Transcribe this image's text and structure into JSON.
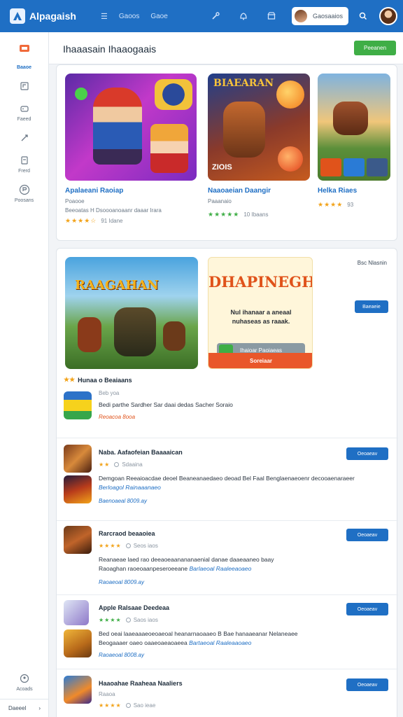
{
  "header": {
    "brand": "Alpagaish",
    "nav": [
      "Gaoos",
      "Gaoe"
    ],
    "user_name": "Gaosaaios"
  },
  "sidebar": {
    "items": [
      {
        "label": "Baaoe",
        "icon": "home-icon"
      },
      {
        "label": "",
        "icon": "store-icon"
      },
      {
        "label": "Faeed",
        "icon": "gamepad-icon"
      },
      {
        "label": "",
        "icon": "rocket-icon"
      },
      {
        "label": "Frerd",
        "icon": "library-icon"
      },
      {
        "label": "Poosans",
        "icon": "profile-icon"
      }
    ],
    "bottom_item": "Acoads",
    "footer": "Daeeel"
  },
  "page": {
    "title": "Ihaaasain Ihaaogaais",
    "action_button": "Peeanen"
  },
  "featured": [
    {
      "title": "Apalaeani Raoiap",
      "line1": "Poaooe",
      "line2": "Beeoatas H Dsoooanoaanr daaar Irara",
      "stars": "★★★★☆",
      "count": "91 Idane",
      "star_color": "orange"
    },
    {
      "title": "Naaoaeian Daangir",
      "line1": "Paaanaio",
      "line2": "",
      "stars": "★★★★★",
      "count": "10 Ibaans",
      "star_color": "green"
    },
    {
      "title": "Helka Riaes",
      "line1": "",
      "line2": "",
      "stars": "★★★★",
      "count": "93",
      "star_color": "orange"
    }
  ],
  "featured_art_text": [
    "BIAEARAN",
    "ZIOIS"
  ],
  "promo": {
    "art_text": "RAAGAHAN",
    "title": "DHAPINEGH",
    "text": "Nul ihanaar a aneaal nuhaseas as raaak.",
    "install_label": "Ihaioar Paoiaeas",
    "cta": "Soreiaar",
    "see_all": "Bsc Nlasnin",
    "side_button": "Baeaeie"
  },
  "section_heading": "Hunaa o Beaiaans",
  "list": [
    {
      "title": "Beb yoa",
      "meta_stars": "",
      "meta_text": "",
      "desc": "Bedi parthe Sardher Sar daai dedas Sacher Soraio",
      "desc_link": "",
      "price": "Reoacoa 8ooa",
      "price_style": "orange",
      "button": ""
    },
    {
      "title": "Naba. Aafaofeian Baaaaican",
      "meta_stars": "★★",
      "meta_text": "Sdaaina",
      "desc": "Demgoan Reeaioacdae deoel Beaneanaedaeo deoad Bel Faal Benglaenaeoenr decooaenaraeer",
      "desc_link": "Berloagol Rainaaanaeo",
      "price": "Baenoaeal 8009.ay",
      "price_style": "blue",
      "button": "Oeoaeav"
    },
    {
      "title": "Rarcraod beaaoiea",
      "meta_stars": "★★★★",
      "meta_text": "Seos iaos",
      "desc": "Reanaeae laed rao deeaoeaanananaenial danae daaeaaneo baay",
      "desc_link": "Barlaeoal Raaleeaoaeo",
      "desc_prefix": "Raoaghan raoeoaanpeseroeeane",
      "price": "Raoaeoal 8009.ay",
      "price_style": "blue",
      "button": "Oeoaeav"
    },
    {
      "title": "Apple Ralsaae Deedeaa",
      "meta_stars": "★★★★",
      "meta_text": "Saos iaos",
      "desc": "Bed oeai laaeaaaeoeoaeoal heanarnaoaaeo B Bae hanaaeanar Nelaneaee",
      "desc_link": "Bartaeoal Raaleaaoaeo",
      "desc_prefix": "Beogaaaer oaeo oaaeoaeaoaeea",
      "price": "Raoaeoal 8008.ay",
      "price_style": "blue",
      "button": "Oeoaeav"
    },
    {
      "title": "Haaoahae Raaheaa Naaliers",
      "meta_stars": "★★★★",
      "meta_text": "Sao ieae",
      "desc": "Raaoa",
      "desc_link": "",
      "price": "",
      "price_style": "blue",
      "button": "Oeoaeav"
    }
  ]
}
